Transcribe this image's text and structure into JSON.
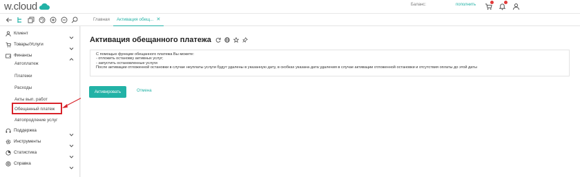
{
  "header": {
    "logo_text": "w.cloud",
    "balance_label": "Баланс:",
    "balance_value": "",
    "topup_label": "пополнить",
    "accent_color": "#22b2a6"
  },
  "tabs": [
    {
      "label": "Главная"
    },
    {
      "label": "Активация обещ..."
    }
  ],
  "sidebar": {
    "items": [
      {
        "label": "Клиент",
        "icon": "user-icon"
      },
      {
        "label": "Товары/Услуги",
        "icon": "cart-icon"
      },
      {
        "label": "Финансы",
        "icon": "wallet-icon"
      },
      {
        "label": "Поддержка",
        "icon": "support-icon"
      },
      {
        "label": "Инструменты",
        "icon": "gear-icon"
      },
      {
        "label": "Статистика",
        "icon": "pie-icon"
      },
      {
        "label": "Справка",
        "icon": "help-icon"
      }
    ],
    "finance_sub": [
      {
        "label": "Автоплатеж"
      },
      {
        "label": "Платежи"
      },
      {
        "label": "Расходы"
      },
      {
        "label": "Акты вып. работ"
      },
      {
        "label": "Обещанный платеж"
      },
      {
        "label": "Автопродление услуг"
      }
    ]
  },
  "main": {
    "title": "Активация обещанного платежа",
    "info_lines": [
      "С помощью функции обещанного платежа Вы можете:",
      "- отложить остановку активных услуг;",
      "- запустить остановленные услуги",
      "После активации отложенной остановки в случае неуплаты услуги будут удалены в указанную дату, в скобках указана дата удаления в случае активации отложенной остановки и отсутствия оплаты до этой даты"
    ],
    "activate_label": "Активировать",
    "cancel_label": "Отмена"
  }
}
